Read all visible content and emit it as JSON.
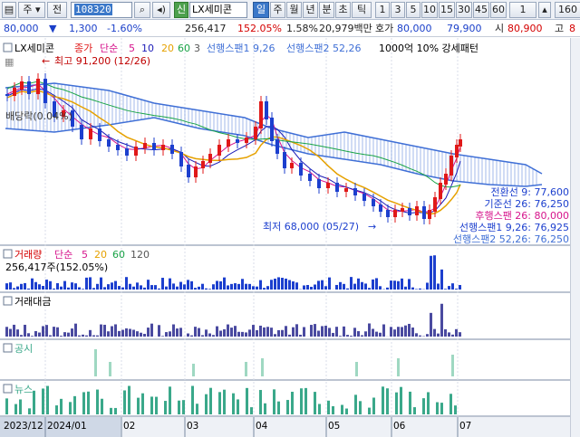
{
  "toolbar": {
    "stock_sort": "주",
    "market": "전",
    "code": "108320",
    "stock_name": "LX세미콘",
    "new_badge": "신",
    "periods": [
      "일",
      "주",
      "월",
      "년",
      "분",
      "초",
      "틱"
    ],
    "active_period": "일",
    "intervals": [
      "1",
      "3",
      "5",
      "10",
      "15",
      "30",
      "45",
      "60",
      "1"
    ],
    "count": "160"
  },
  "quote": {
    "price": "80,000",
    "change": "1,300",
    "change_pct": "-1.60%",
    "volume": "256,417",
    "volume_ratio": "152.05%",
    "turnover": "1.58%",
    "amount": "20,979백만",
    "label_open": "호가",
    "bid": "80,000",
    "ask": "79,900",
    "label_open2": "시",
    "open": "80,900",
    "label_high": "고",
    "high_trunc": "8"
  },
  "price_panel": {
    "title": "LX세미콘",
    "legend_close": "종가",
    "legend_ma": "단순",
    "ma_periods": [
      "5",
      "10",
      "20",
      "60",
      "3"
    ],
    "ichimoku1": "선행스팬1 9,26",
    "ichimoku2": "선행스팬2 52,26",
    "pattern": "1000억 10% 강세패턴",
    "annot_high": "최고 91,200 (12/26)",
    "annot_low": "최저 68,000 (05/27)",
    "annot_left": "배당락(0.04%)",
    "right_labels": [
      "전환선 9: 77,600",
      "기준선 26: 76,250",
      "후행스팬 26: 80,000",
      "선행스팬1 9,26: 76,925",
      "선행스팬2 52,26: 76,250"
    ],
    "colors": {
      "candle_up": "#e01818",
      "candle_down": "#1c3fce",
      "ma5": "#d6148c",
      "ma10": "#1c1cb8",
      "ma20": "#e6a100",
      "ma60": "#19a346",
      "cloud": "#3f6fd6"
    }
  },
  "volume_panel": {
    "title": "거래량",
    "ma_label": "단순",
    "ma_periods": [
      "5",
      "20",
      "60",
      "120"
    ],
    "value": "256,417주(152.05%)"
  },
  "amount_panel": {
    "title": "거래대금"
  },
  "disclosure_panel": {
    "title": "공시"
  },
  "news_panel": {
    "title": "뉴스"
  },
  "xaxis": {
    "labels": [
      "2023/12",
      "2024/01",
      "02",
      "03",
      "04",
      "05",
      "06",
      "07"
    ]
  },
  "chart_data": {
    "type": "candlestick",
    "x_start": "2023-12",
    "x_end": "2024-07",
    "price_high": 91200,
    "price_high_date": "12/26",
    "price_low": 68000,
    "price_low_date": "05/27",
    "last_close": 80000,
    "tenkan_9": 77600,
    "kijun_26": 76250,
    "chikou_26": 80000,
    "senkou1_9_26": 76925,
    "senkou2_52_26": 76250
  }
}
